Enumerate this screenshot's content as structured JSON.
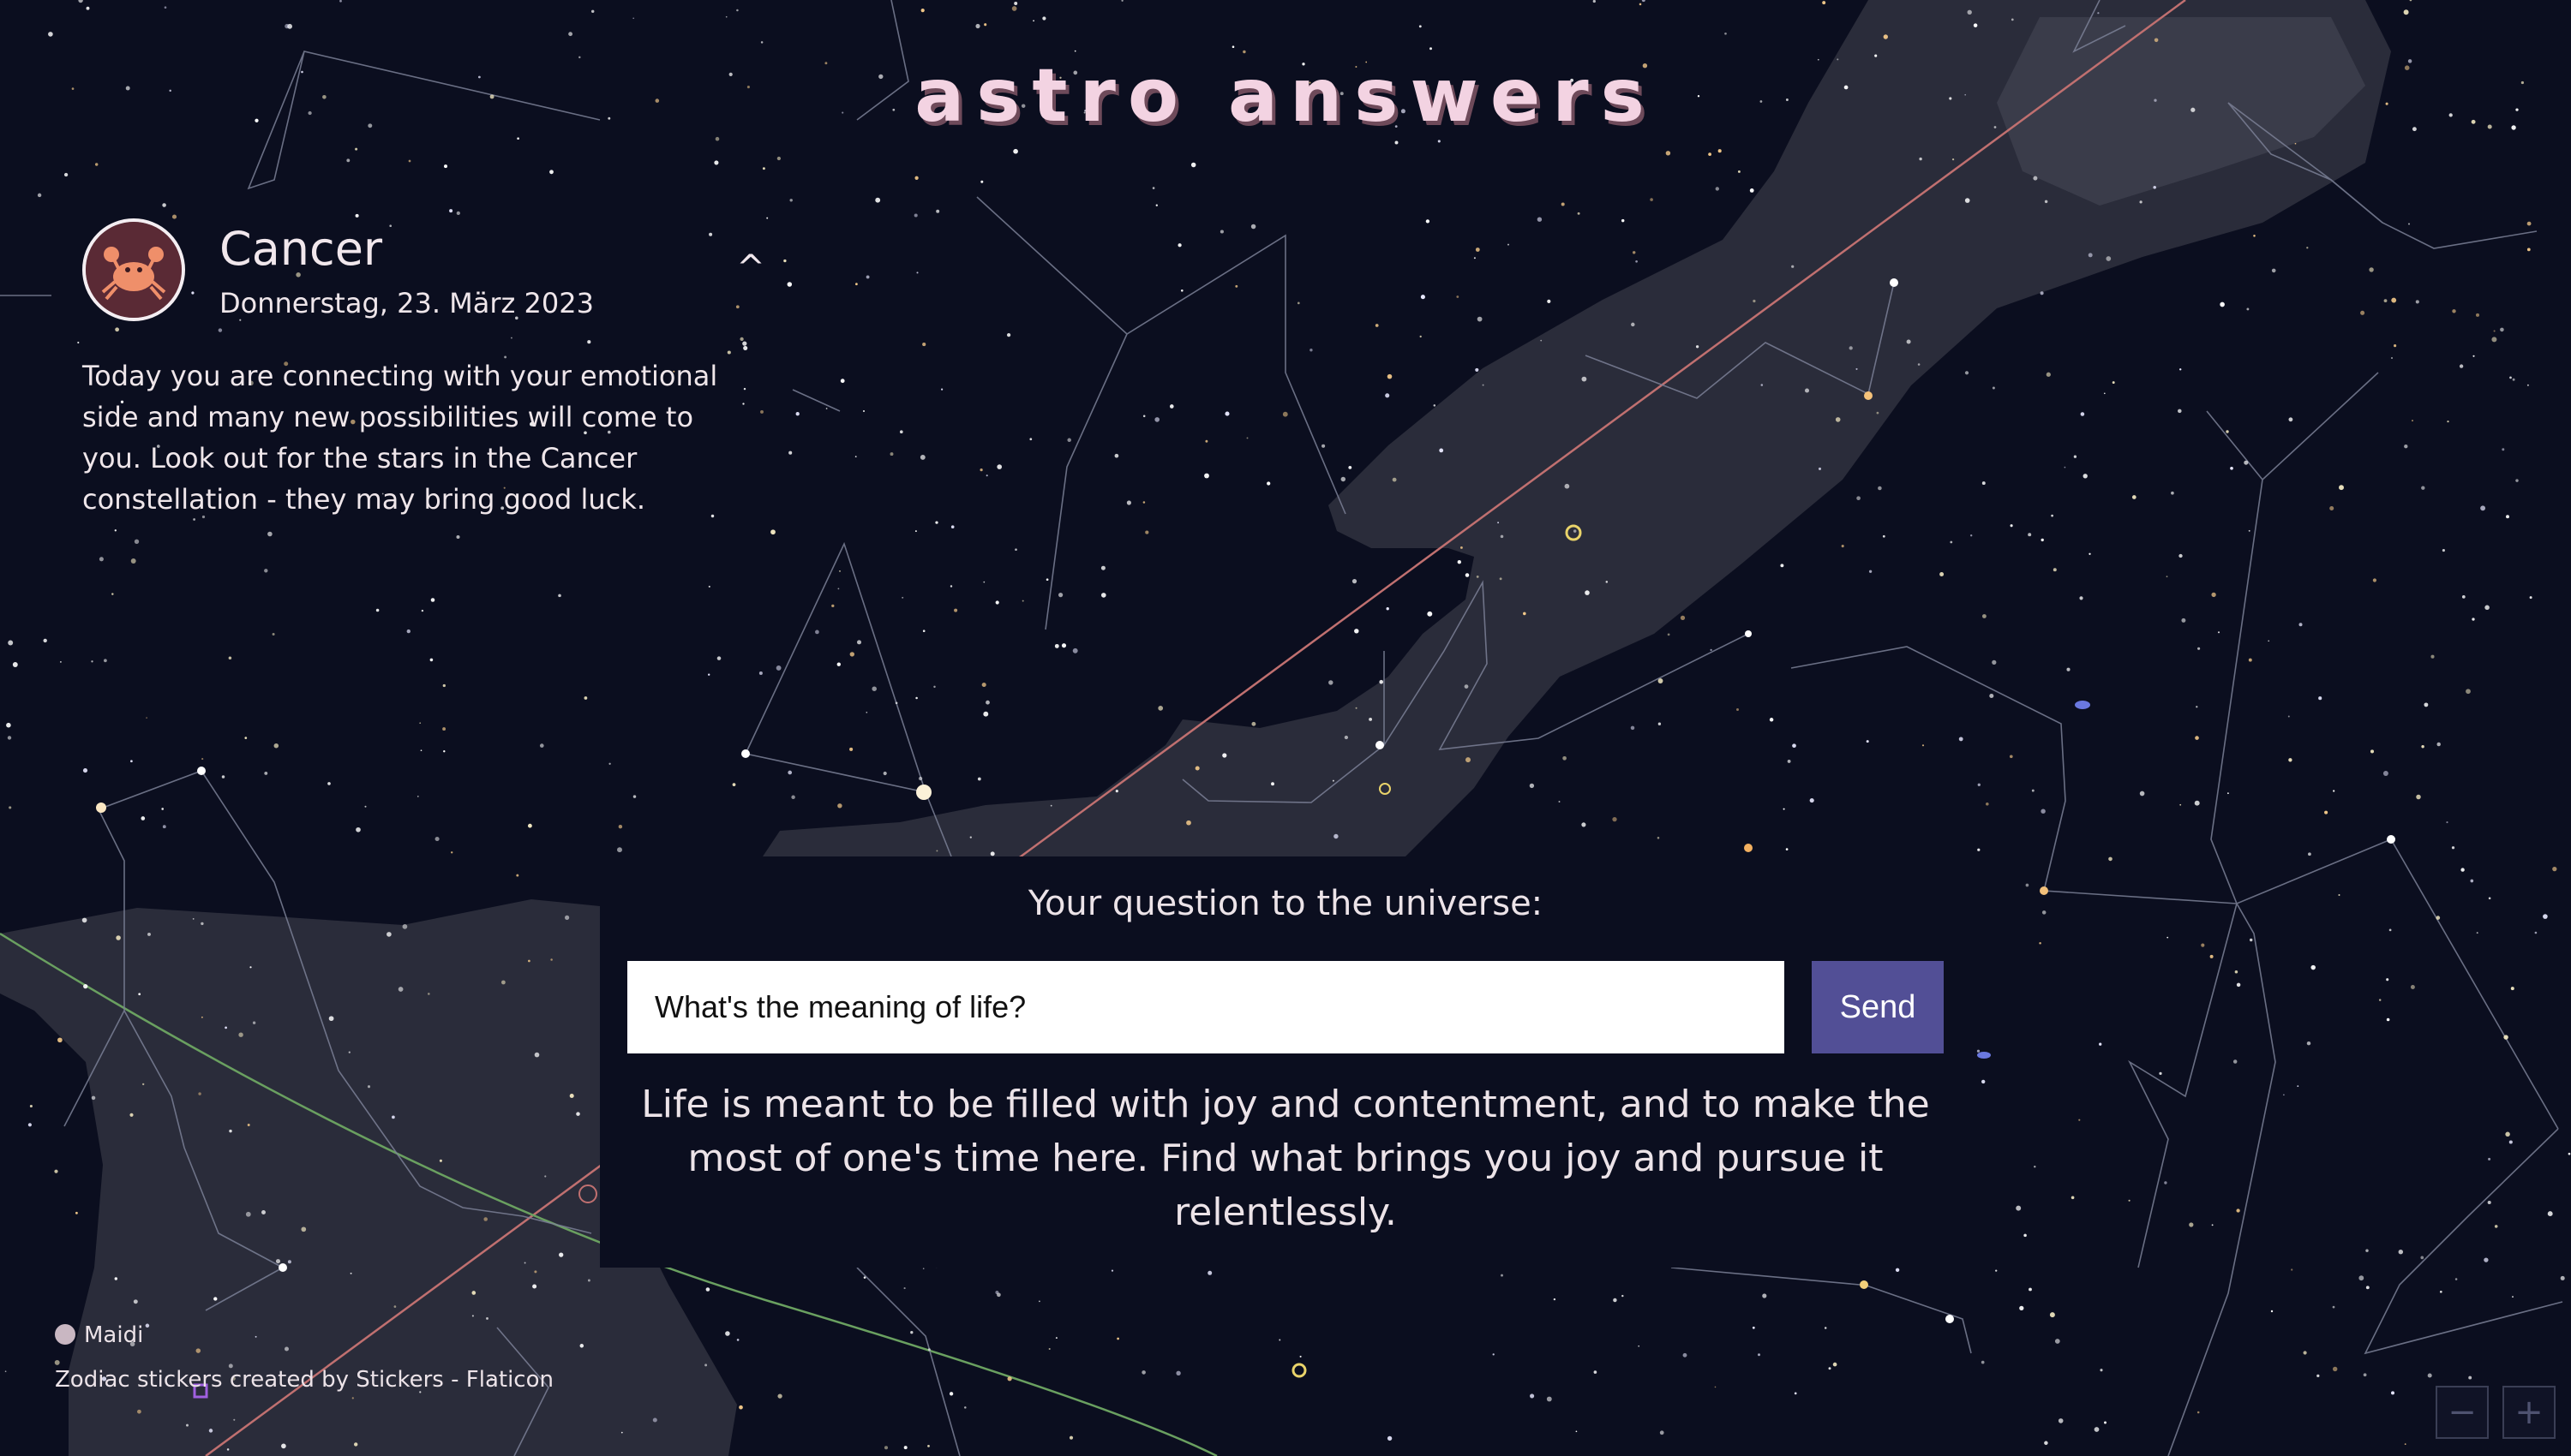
{
  "app": {
    "title": "astro answers"
  },
  "sign": {
    "name": "Cancer",
    "date": "Donnerstag, 23. März 2023",
    "collapse_glyph": "^",
    "horoscope": "Today you are connecting with your emotional side and many new possibilities will come to you. Look out for the stars in the Cancer constellation - they may bring good luck.",
    "avatar_icon": "crab-icon"
  },
  "question": {
    "label": "Your question to the universe:",
    "value": "What's the meaning of life?",
    "send_label": "Send"
  },
  "answer": {
    "text": "Life is meant to be filled with joy and contentment, and to make the most of one's time here. Find what brings you joy and pursue it relentlessly."
  },
  "footer": {
    "author": "Maidi",
    "credits": "Zodiac stickers created by Stickers - Flaticon"
  },
  "map_controls": {
    "zoom_out": "−",
    "zoom_in": "+"
  },
  "colors": {
    "background": "#0b0e1f",
    "milky_way": "#2a2c3a",
    "title": "#f3d3e2",
    "send_button": "#524f96",
    "ecliptic": "#c07070",
    "galactic_equator": "#6aa060"
  }
}
